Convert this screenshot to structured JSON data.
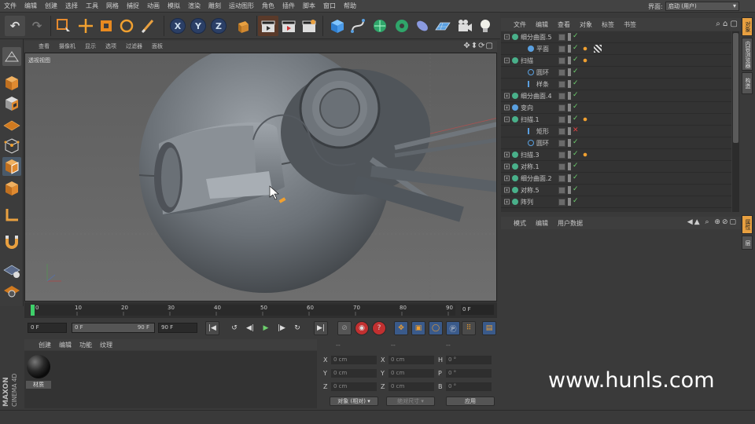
{
  "menubar": {
    "items": [
      "文件",
      "编辑",
      "创建",
      "选择",
      "工具",
      "网格",
      "捕捉",
      "动画",
      "模拟",
      "渲染",
      "雕刻",
      "运动图形",
      "角色",
      "插件",
      "脚本",
      "窗口",
      "帮助"
    ],
    "layout_label": "界面:",
    "layout_value": "启动 (用户)"
  },
  "viewport": {
    "menu": [
      "查看",
      "摄像机",
      "显示",
      "选项",
      "过滤器",
      "面板"
    ],
    "label": "透视视图"
  },
  "timeline": {
    "ticks": [
      "0",
      "10",
      "20",
      "30",
      "40",
      "50",
      "60",
      "70",
      "80",
      "90"
    ],
    "frame": "0 F"
  },
  "playback": {
    "start": "0 F",
    "range_start": "0 F",
    "range_end": "90 F",
    "end": "90 F"
  },
  "material": {
    "menu": [
      "创建",
      "编辑",
      "功能",
      "纹理"
    ],
    "name": "材质"
  },
  "brand": {
    "maxon": "MAXON",
    "product": "CINEMA 4D"
  },
  "coord": {
    "header1": "--",
    "header2": "--",
    "header3": "--",
    "rows": [
      {
        "a": "X",
        "av": "0 cm",
        "b": "X",
        "bv": "0 cm",
        "c": "H",
        "cv": "0 °"
      },
      {
        "a": "Y",
        "av": "0 cm",
        "b": "Y",
        "bv": "0 cm",
        "c": "P",
        "cv": "0 °"
      },
      {
        "a": "Z",
        "av": "0 cm",
        "b": "Z",
        "bv": "0 cm",
        "c": "B",
        "cv": "0 °"
      }
    ],
    "mode": "对象 (相对)",
    "size": "绝对尺寸",
    "apply": "应用"
  },
  "objects": {
    "menu": [
      "文件",
      "编辑",
      "查看",
      "对象",
      "标签",
      "书签"
    ],
    "rows": [
      {
        "name": "细分曲面.5",
        "indent": 0,
        "icon": "#49b08a"
      },
      {
        "name": "平面",
        "indent": 1,
        "icon": "#5aa0e0"
      },
      {
        "name": "扫描",
        "indent": 0,
        "icon": "#49b08a"
      },
      {
        "name": "圆环",
        "indent": 1,
        "icon": "#5aa0e0"
      },
      {
        "name": "样条",
        "indent": 1,
        "icon": "#5aa0e0"
      },
      {
        "name": "细分曲面.4",
        "indent": 0,
        "icon": "#49b08a"
      },
      {
        "name": "变向",
        "indent": 0,
        "icon": "#5aa0e0"
      },
      {
        "name": "扫描.1",
        "indent": 0,
        "icon": "#49b08a"
      },
      {
        "name": "矩形",
        "indent": 1,
        "icon": "#5aa0e0"
      },
      {
        "name": "圆环",
        "indent": 1,
        "icon": "#5aa0e0"
      },
      {
        "name": "扫描.3",
        "indent": 0,
        "icon": "#49b08a"
      },
      {
        "name": "对称.1",
        "indent": 0,
        "icon": "#49b08a"
      },
      {
        "name": "细分曲面.2",
        "indent": 0,
        "icon": "#49b08a"
      },
      {
        "name": "对称.5",
        "indent": 0,
        "icon": "#49b08a"
      },
      {
        "name": "阵列",
        "indent": 0,
        "icon": "#49b08a"
      }
    ]
  },
  "attributes": {
    "menu": [
      "模式",
      "编辑",
      "用户数据"
    ]
  },
  "right_tabs": [
    "对象",
    "内容浏览器",
    "构造",
    "属性",
    "层"
  ],
  "watermark": "www.hunls.com"
}
